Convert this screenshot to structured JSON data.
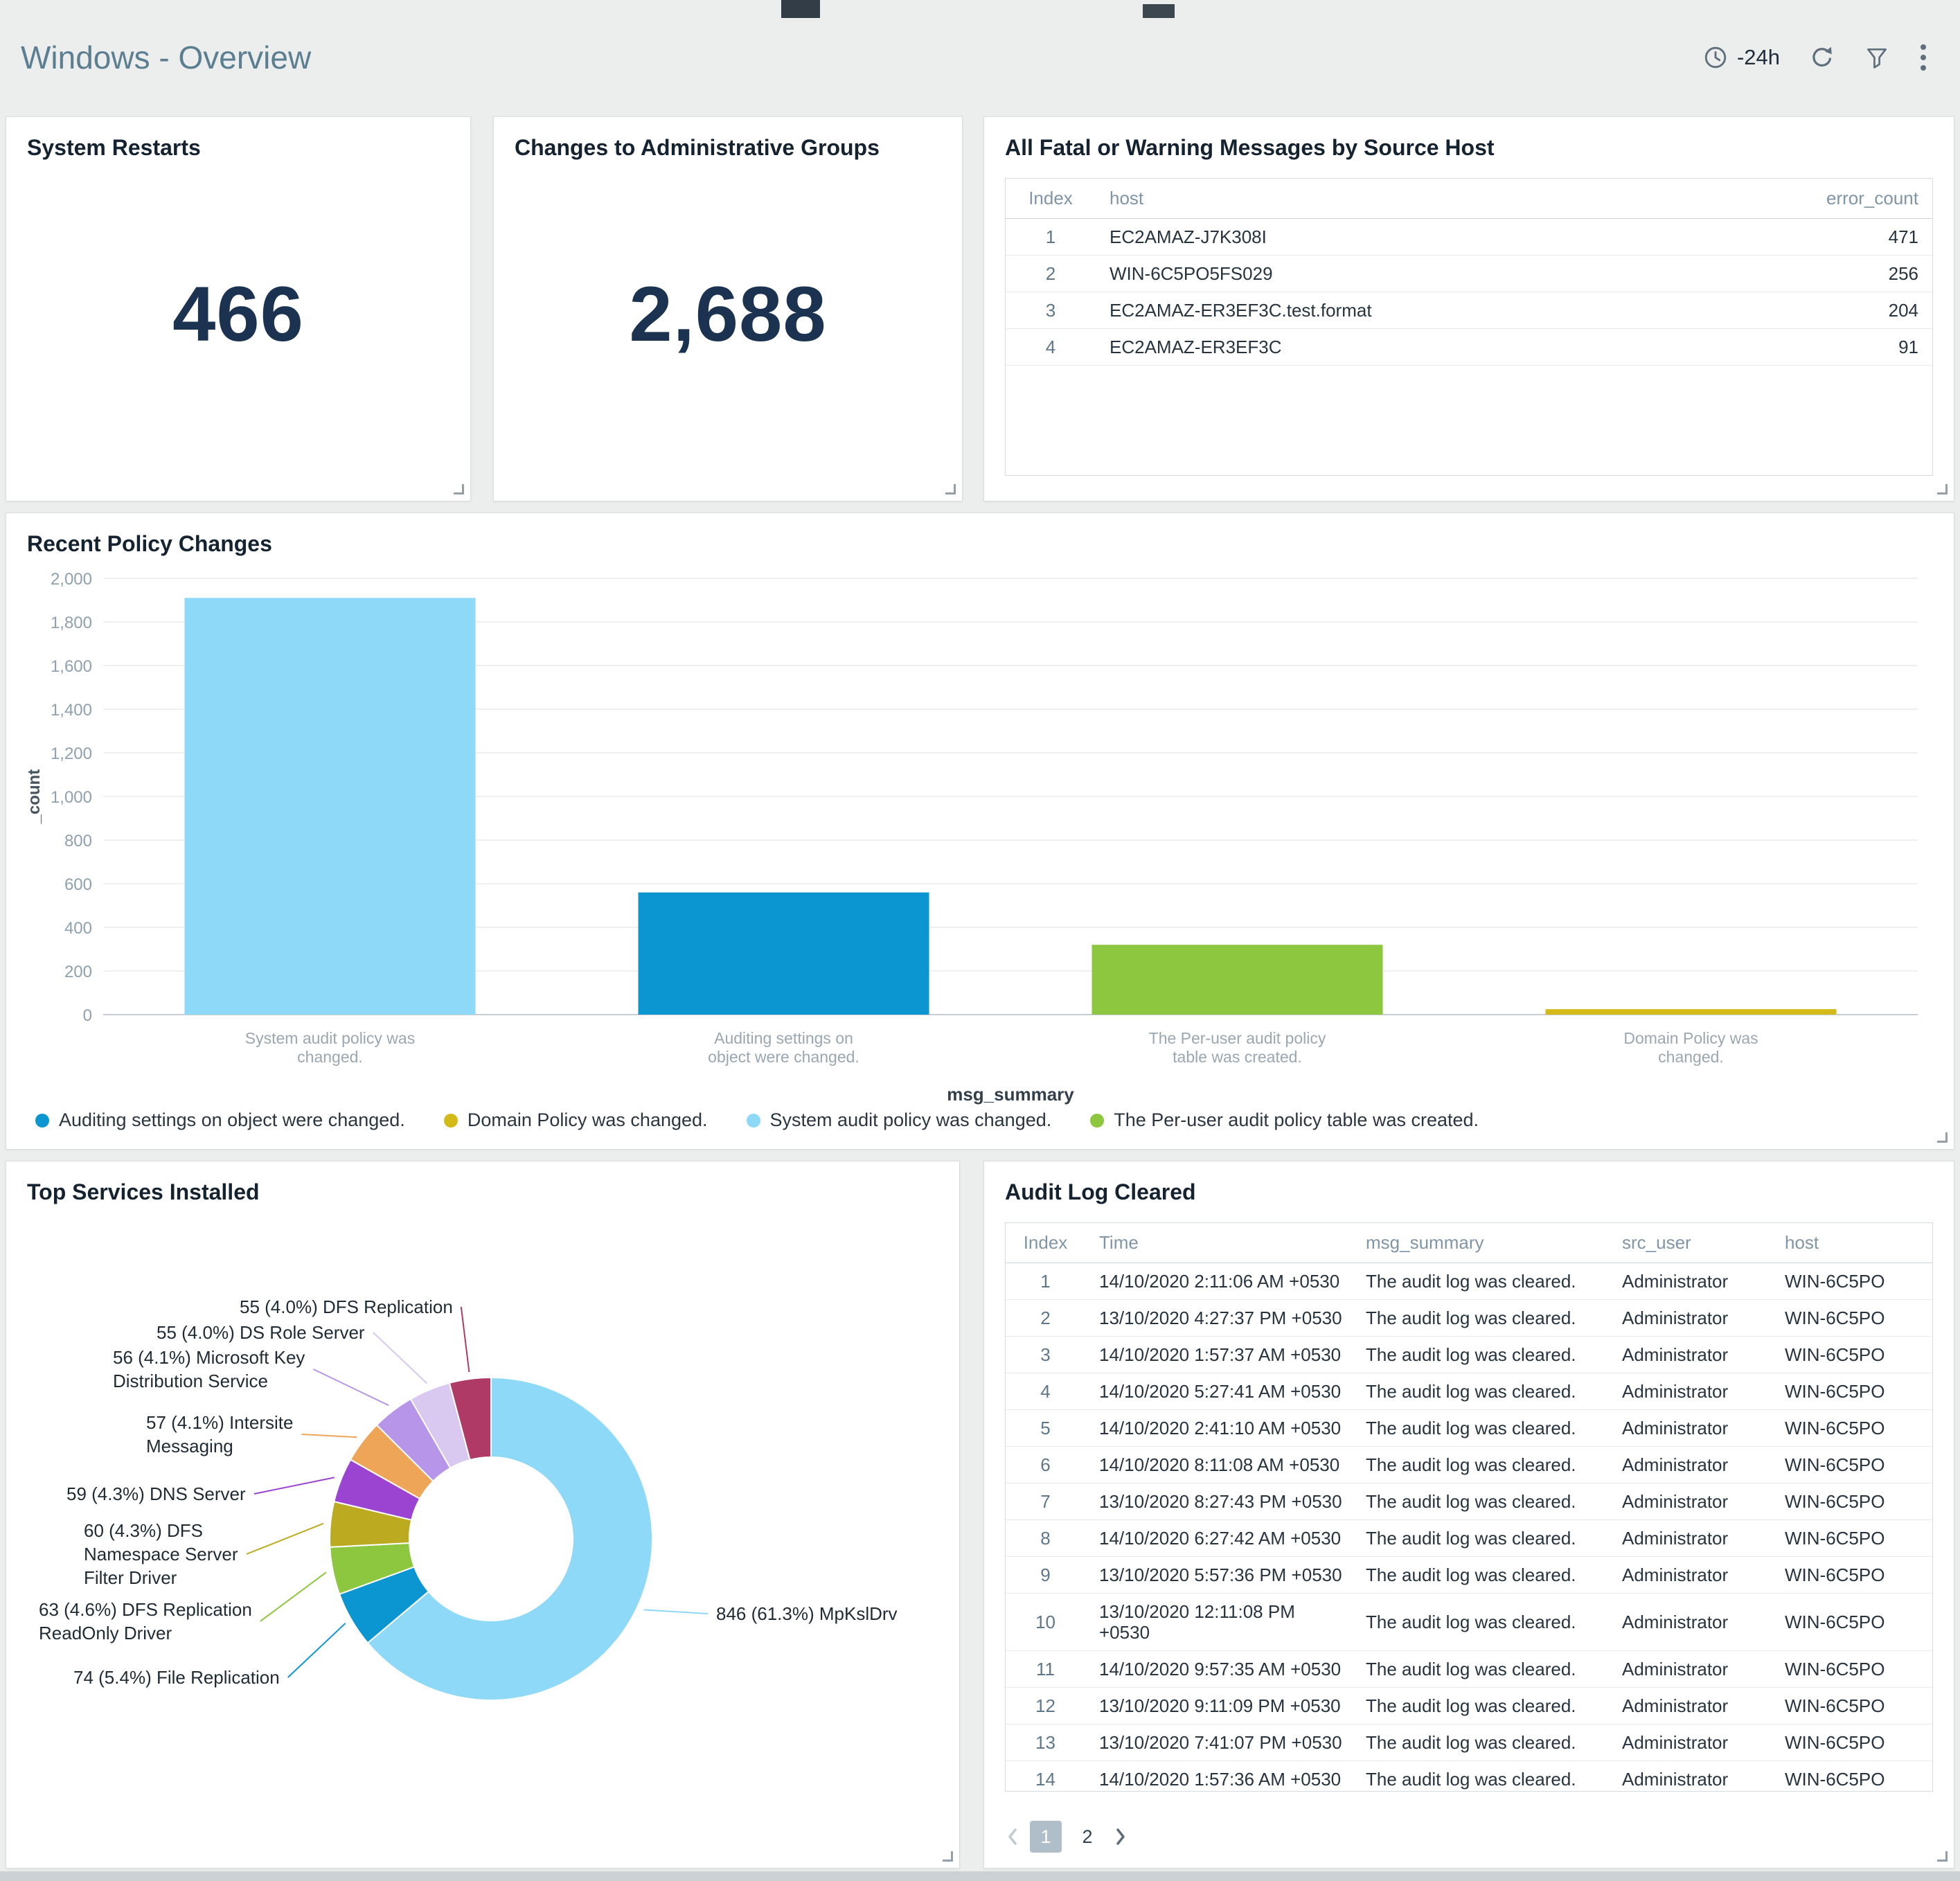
{
  "header": {
    "title": "Windows - Overview",
    "time_range": "-24h",
    "icons": [
      "clock-icon",
      "refresh-icon",
      "filter-icon",
      "kebab-menu-icon"
    ]
  },
  "panels": {
    "system_restarts": {
      "title": "System Restarts",
      "value": "466"
    },
    "admin_groups": {
      "title": "Changes to Administrative Groups",
      "value": "2,688"
    },
    "fatal_messages": {
      "title": "All Fatal or Warning Messages by Source Host",
      "columns": [
        "Index",
        "host",
        "error_count"
      ],
      "rows": [
        [
          "1",
          "EC2AMAZ-J7K308I",
          "471"
        ],
        [
          "2",
          "WIN-6C5PO5FS029",
          "256"
        ],
        [
          "3",
          "EC2AMAZ-ER3EF3C.test.format",
          "204"
        ],
        [
          "4",
          "EC2AMAZ-ER3EF3C",
          "91"
        ]
      ]
    },
    "policy_changes": {
      "title": "Recent Policy Changes"
    },
    "top_services": {
      "title": "Top Services Installed"
    },
    "audit_log": {
      "title": "Audit Log Cleared",
      "columns": [
        "Index",
        "Time",
        "msg_summary",
        "src_user",
        "host"
      ],
      "rows": [
        [
          "1",
          "14/10/2020 2:11:06 AM +0530",
          "The audit log was cleared.",
          "Administrator",
          "WIN-6C5PO"
        ],
        [
          "2",
          "13/10/2020 4:27:37 PM +0530",
          "The audit log was cleared.",
          "Administrator",
          "WIN-6C5PO"
        ],
        [
          "3",
          "14/10/2020 1:57:37 AM +0530",
          "The audit log was cleared.",
          "Administrator",
          "WIN-6C5PO"
        ],
        [
          "4",
          "14/10/2020 5:27:41 AM +0530",
          "The audit log was cleared.",
          "Administrator",
          "WIN-6C5PO"
        ],
        [
          "5",
          "14/10/2020 2:41:10 AM +0530",
          "The audit log was cleared.",
          "Administrator",
          "WIN-6C5PO"
        ],
        [
          "6",
          "14/10/2020 8:11:08 AM +0530",
          "The audit log was cleared.",
          "Administrator",
          "WIN-6C5PO"
        ],
        [
          "7",
          "13/10/2020 8:27:43 PM +0530",
          "The audit log was cleared.",
          "Administrator",
          "WIN-6C5PO"
        ],
        [
          "8",
          "14/10/2020 6:27:42 AM +0530",
          "The audit log was cleared.",
          "Administrator",
          "WIN-6C5PO"
        ],
        [
          "9",
          "13/10/2020 5:57:36 PM +0530",
          "The audit log was cleared.",
          "Administrator",
          "WIN-6C5PO"
        ],
        [
          "10",
          "13/10/2020 12:11:08 PM\n+0530",
          "The audit log was cleared.",
          "Administrator",
          "WIN-6C5PO"
        ],
        [
          "11",
          "14/10/2020 9:57:35 AM +0530",
          "The audit log was cleared.",
          "Administrator",
          "WIN-6C5PO"
        ],
        [
          "12",
          "13/10/2020 9:11:09 PM +0530",
          "The audit log was cleared.",
          "Administrator",
          "WIN-6C5PO"
        ],
        [
          "13",
          "13/10/2020 7:41:07 PM +0530",
          "The audit log was cleared.",
          "Administrator",
          "WIN-6C5PO"
        ],
        [
          "14",
          "14/10/2020 1:57:36 AM +0530",
          "The audit log was cleared.",
          "Administrator",
          "WIN-6C5PO"
        ]
      ],
      "pagination": {
        "pages": [
          "1",
          "2"
        ],
        "current": "1"
      }
    }
  },
  "chart_data": [
    {
      "id": "recent-policy-changes",
      "type": "bar",
      "title": "Recent Policy Changes",
      "xlabel": "msg_summary",
      "ylabel": "_count",
      "ylim": [
        0,
        2000
      ],
      "y_tick_step": 200,
      "grid": true,
      "legend_position": "bottom",
      "categories": [
        "System audit policy was changed.",
        "Auditing settings on object were changed.",
        "The Per-user audit policy table was created.",
        "Domain Policy was changed."
      ],
      "values": [
        1910,
        560,
        320,
        25
      ],
      "colors": [
        "#8ed8f8",
        "#0b96d2",
        "#8dc63f",
        "#d4ba18"
      ],
      "legend": [
        {
          "label": "Auditing settings on object were changed.",
          "color": "#0b96d2"
        },
        {
          "label": "Domain Policy was changed.",
          "color": "#d4ba18"
        },
        {
          "label": "System audit policy was changed.",
          "color": "#8ed8f8"
        },
        {
          "label": "The Per-user audit policy table was created.",
          "color": "#8dc63f"
        }
      ]
    },
    {
      "id": "top-services-installed",
      "type": "pie",
      "donut": true,
      "title": "Top Services Installed",
      "slices": [
        {
          "label": "MpKslDrv",
          "value": 846,
          "pct": "61.3",
          "color": "#8ed8f8"
        },
        {
          "label": "File Replication",
          "value": 74,
          "pct": "5.4",
          "color": "#0b96d2"
        },
        {
          "label": "DFS Replication ReadOnly Driver",
          "value": 63,
          "pct": "4.6",
          "color": "#8dc63f"
        },
        {
          "label": "DFS Namespace Server Filter Driver",
          "value": 60,
          "pct": "4.3",
          "color": "#bcab20"
        },
        {
          "label": "DNS Server",
          "value": 59,
          "pct": "4.3",
          "color": "#9a44d1"
        },
        {
          "label": "Intersite Messaging",
          "value": 57,
          "pct": "4.1",
          "color": "#efa558"
        },
        {
          "label": "Microsoft Key Distribution Service",
          "value": 56,
          "pct": "4.1",
          "color": "#b795e8"
        },
        {
          "label": "DS Role Server",
          "value": 55,
          "pct": "4.0",
          "color": "#d9c8f0"
        },
        {
          "label": "DFS Replication",
          "value": 55,
          "pct": "4.0",
          "color": "#b03a66"
        }
      ]
    }
  ]
}
